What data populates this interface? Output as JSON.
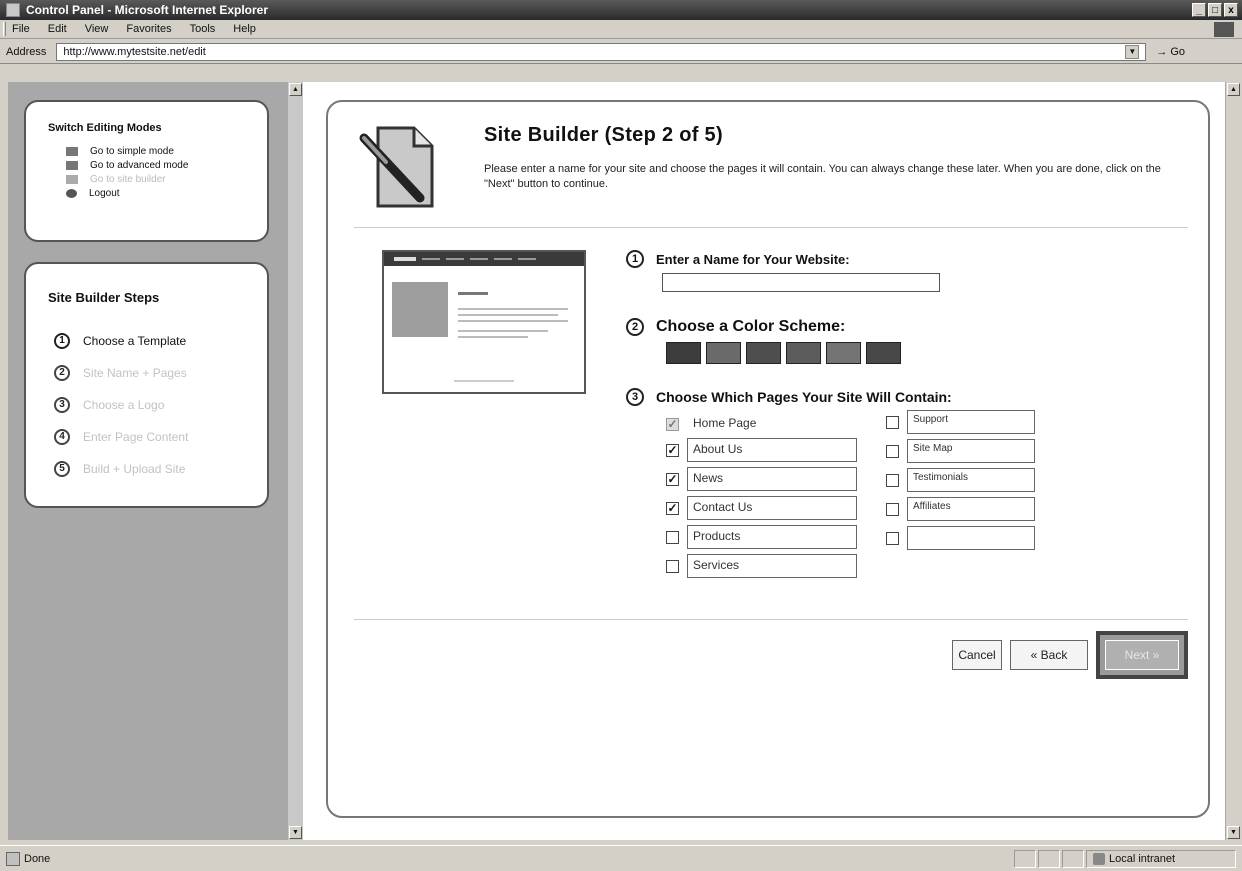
{
  "window": {
    "title": "Control Panel - Microsoft Internet Explorer",
    "controls": [
      "_",
      "□",
      "x"
    ]
  },
  "menu": [
    "File",
    "Edit",
    "View",
    "Favorites",
    "Tools",
    "Help"
  ],
  "address": {
    "label": "Address",
    "url": "http://www.mytestsite.net/edit",
    "go_label": "Go"
  },
  "modes": {
    "title": "Switch Editing Modes",
    "items": [
      {
        "label": "Go to simple mode",
        "icon": "simple-mode-icon",
        "active": true
      },
      {
        "label": "Go to advanced mode",
        "icon": "advanced-mode-icon",
        "active": true
      },
      {
        "label": "Go to site builder",
        "icon": "site-builder-icon",
        "active": false
      },
      {
        "label": "Logout",
        "icon": "logout-icon",
        "active": true
      }
    ]
  },
  "steps": {
    "title": "Site Builder Steps",
    "items": [
      {
        "num": "1",
        "label": "Choose a Template"
      },
      {
        "num": "2",
        "label": "Site Name + Pages"
      },
      {
        "num": "3",
        "label": "Choose a Logo"
      },
      {
        "num": "4",
        "label": "Enter Page Content"
      },
      {
        "num": "5",
        "label": "Build + Upload Site"
      }
    ]
  },
  "main": {
    "title": "Site Builder (Step 2 of 5)",
    "intro": "Please enter a name for your site and choose the pages it will contain. You can always change these later. When you are done, click on the \"Next\" button to continue.",
    "q1": {
      "num": "1",
      "label": "Enter a Name for Your Website:",
      "value": ""
    },
    "q2": {
      "num": "2",
      "label": "Choose a Color Scheme:"
    },
    "q3": {
      "num": "3",
      "label": "Choose Which Pages Your Site Will Contain:"
    },
    "color_swatches": [
      "#3c3c3c",
      "#6a6a6a",
      "#4e4e4e",
      "#5c5c5c",
      "#737373",
      "#484848"
    ],
    "pages_left": [
      {
        "label": "Home Page",
        "checked": true
      },
      {
        "label": "About Us",
        "checked": true
      },
      {
        "label": "News",
        "checked": true
      },
      {
        "label": "Contact Us",
        "checked": true
      },
      {
        "label": "Products",
        "checked": false
      },
      {
        "label": "Services",
        "checked": false
      }
    ],
    "pages_right": [
      {
        "label": "Support",
        "checked": false
      },
      {
        "label": "Site Map",
        "checked": false
      },
      {
        "label": "Testimonials",
        "checked": false
      },
      {
        "label": "Affiliates",
        "checked": false
      },
      {
        "label": "",
        "checked": false
      }
    ],
    "buttons": {
      "cancel": "Cancel",
      "back": "« Back",
      "next": "Next »"
    }
  },
  "status": {
    "text": "Done",
    "zone": "Local intranet"
  }
}
